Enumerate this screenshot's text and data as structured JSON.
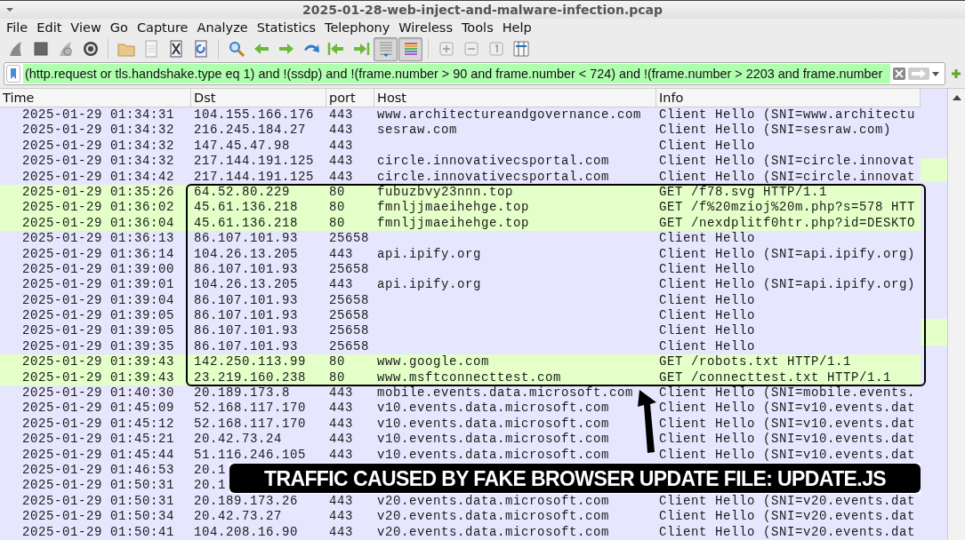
{
  "window": {
    "title": "2025-01-28-web-inject-and-malware-infection.pcap"
  },
  "menu": [
    "File",
    "Edit",
    "View",
    "Go",
    "Capture",
    "Analyze",
    "Statistics",
    "Telephony",
    "Wireless",
    "Tools",
    "Help"
  ],
  "toolbar": [
    [
      {
        "kind": "start",
        "pressed": false
      },
      {
        "kind": "stop",
        "pressed": false
      },
      {
        "kind": "restart",
        "pressed": false
      },
      {
        "kind": "options",
        "pressed": false
      }
    ],
    [
      {
        "kind": "open",
        "pressed": false
      },
      {
        "kind": "save",
        "pressed": false
      },
      {
        "kind": "close",
        "pressed": false
      },
      {
        "kind": "reload",
        "pressed": false
      }
    ],
    [
      {
        "kind": "find",
        "pressed": false
      },
      {
        "kind": "back",
        "pressed": false
      },
      {
        "kind": "forward",
        "pressed": false
      },
      {
        "kind": "goto",
        "pressed": false
      },
      {
        "kind": "first",
        "pressed": false
      },
      {
        "kind": "last",
        "pressed": false
      },
      {
        "kind": "autoscroll",
        "pressed": true
      },
      {
        "kind": "colorize",
        "pressed": true
      }
    ],
    [
      {
        "kind": "zoom-in",
        "pressed": false
      },
      {
        "kind": "zoom-out",
        "pressed": false
      },
      {
        "kind": "zoom-reset",
        "pressed": false
      },
      {
        "kind": "resize",
        "pressed": false
      }
    ]
  ],
  "filter": {
    "value": "(http.request or tls.handshake.type eq 1) and !(ssdp) and !(frame.number > 90 and frame.number < 724) and !(frame.number > 2203 and frame.number",
    "valid": true
  },
  "table": {
    "columns": [
      "Time",
      "Dst",
      "port",
      "Host",
      "Info"
    ],
    "rows": [
      {
        "time": "2025-01-29 01:34:31",
        "dst": "104.155.166.176",
        "port": "443",
        "host": "www.architectureandgovernance.com",
        "info": "Client Hello (SNI=www.architectu",
        "color": "#e7e6ff"
      },
      {
        "time": "2025-01-29 01:34:32",
        "dst": "216.245.184.27",
        "port": "443",
        "host": "sesraw.com",
        "info": "Client Hello (SNI=sesraw.com)",
        "color": "#e7e6ff"
      },
      {
        "time": "2025-01-29 01:34:32",
        "dst": "147.45.47.98",
        "port": "443",
        "host": "",
        "info": "Client Hello",
        "color": "#e7e6ff"
      },
      {
        "time": "2025-01-29 01:34:32",
        "dst": "217.144.191.125",
        "port": "443",
        "host": "circle.innovativecsportal.com",
        "info": "Client Hello (SNI=circle.innovat",
        "color": "#e7e6ff"
      },
      {
        "time": "2025-01-29 01:34:42",
        "dst": "217.144.191.125",
        "port": "443",
        "host": "circle.innovativecsportal.com",
        "info": "Client Hello (SNI=circle.innovat",
        "color": "#e7e6ff"
      },
      {
        "time": "2025-01-29 01:35:26",
        "dst": "64.52.80.229",
        "port": "80",
        "host": "fubuzbvy23nnn.top",
        "info": "GET /f78.svg HTTP/1.1",
        "color": "#e4ffc7"
      },
      {
        "time": "2025-01-29 01:36:02",
        "dst": "45.61.136.218",
        "port": "80",
        "host": "fmnljjmaeihehge.top",
        "info": "GET /f%20mzioj%20m.php?s=578 HTT",
        "color": "#e4ffc7"
      },
      {
        "time": "2025-01-29 01:36:04",
        "dst": "45.61.136.218",
        "port": "80",
        "host": "fmnljjmaeihehge.top",
        "info": "GET /nexdplitf0htr.php?id=DESKTO",
        "color": "#e4ffc7"
      },
      {
        "time": "2025-01-29 01:36:13",
        "dst": "86.107.101.93",
        "port": "25658",
        "host": "",
        "info": "Client Hello",
        "color": "#e7e6ff"
      },
      {
        "time": "2025-01-29 01:36:14",
        "dst": "104.26.13.205",
        "port": "443",
        "host": "api.ipify.org",
        "info": "Client Hello (SNI=api.ipify.org)",
        "color": "#e7e6ff"
      },
      {
        "time": "2025-01-29 01:39:00",
        "dst": "86.107.101.93",
        "port": "25658",
        "host": "",
        "info": "Client Hello",
        "color": "#e7e6ff"
      },
      {
        "time": "2025-01-29 01:39:01",
        "dst": "104.26.13.205",
        "port": "443",
        "host": "api.ipify.org",
        "info": "Client Hello (SNI=api.ipify.org)",
        "color": "#e7e6ff"
      },
      {
        "time": "2025-01-29 01:39:04",
        "dst": "86.107.101.93",
        "port": "25658",
        "host": "",
        "info": "Client Hello",
        "color": "#e7e6ff"
      },
      {
        "time": "2025-01-29 01:39:05",
        "dst": "86.107.101.93",
        "port": "25658",
        "host": "",
        "info": "Client Hello",
        "color": "#e7e6ff"
      },
      {
        "time": "2025-01-29 01:39:05",
        "dst": "86.107.101.93",
        "port": "25658",
        "host": "",
        "info": "Client Hello",
        "color": "#e7e6ff"
      },
      {
        "time": "2025-01-29 01:39:35",
        "dst": "86.107.101.93",
        "port": "25658",
        "host": "",
        "info": "Client Hello",
        "color": "#e7e6ff"
      },
      {
        "time": "2025-01-29 01:39:43",
        "dst": "142.250.113.99",
        "port": "80",
        "host": "www.google.com",
        "info": "GET /robots.txt HTTP/1.1",
        "color": "#e4ffc7"
      },
      {
        "time": "2025-01-29 01:39:43",
        "dst": "23.219.160.238",
        "port": "80",
        "host": "www.msftconnecttest.com",
        "info": "GET /connecttest.txt HTTP/1.1",
        "color": "#e4ffc7"
      },
      {
        "time": "2025-01-29 01:40:30",
        "dst": "20.189.173.8",
        "port": "443",
        "host": "mobile.events.data.microsoft.com",
        "info": "Client Hello (SNI=mobile.events.",
        "color": "#e7e6ff"
      },
      {
        "time": "2025-01-29 01:45:09",
        "dst": "52.168.117.170",
        "port": "443",
        "host": "v10.events.data.microsoft.com",
        "info": "Client Hello (SNI=v10.events.dat",
        "color": "#e7e6ff"
      },
      {
        "time": "2025-01-29 01:45:12",
        "dst": "52.168.117.170",
        "port": "443",
        "host": "v10.events.data.microsoft.com",
        "info": "Client Hello (SNI=v10.events.dat",
        "color": "#e7e6ff"
      },
      {
        "time": "2025-01-29 01:45:21",
        "dst": "20.42.73.24",
        "port": "443",
        "host": "v10.events.data.microsoft.com",
        "info": "Client Hello (SNI=v10.events.dat",
        "color": "#e7e6ff"
      },
      {
        "time": "2025-01-29 01:45:44",
        "dst": "51.116.246.105",
        "port": "443",
        "host": "v10.events.data.microsoft.com",
        "info": "Client Hello (SNI=v10.events.dat",
        "color": "#e7e6ff"
      },
      {
        "time": "2025-01-29 01:46:53",
        "dst": "20.1",
        "color": "#e7e6ff"
      },
      {
        "time": "2025-01-29 01:50:31",
        "dst": "20.1",
        "color": "#e7e6ff"
      },
      {
        "time": "2025-01-29 01:50:31",
        "dst": "20.189.173.26",
        "port": "443",
        "host": "v20.events.data.microsoft.com",
        "info": "Client Hello (SNI=v20.events.dat",
        "color": "#e7e6ff"
      },
      {
        "time": "2025-01-29 01:50:34",
        "dst": "20.42.73.27",
        "port": "443",
        "host": "v20.events.data.microsoft.com",
        "info": "Client Hello (SNI=v20.events.dat",
        "color": "#e7e6ff"
      },
      {
        "time": "2025-01-29 01:50:41",
        "dst": "104.208.16.90",
        "port": "443",
        "host": "v20.events.data.microsoft.com",
        "info": "Client Hello (SNI=v20.events.dat",
        "color": "#e7e6ff"
      }
    ]
  },
  "annotation": {
    "caption": "TRAFFIC CAUSED BY FAKE BROWSER UPDATE FILE: UPDATE.JS"
  }
}
